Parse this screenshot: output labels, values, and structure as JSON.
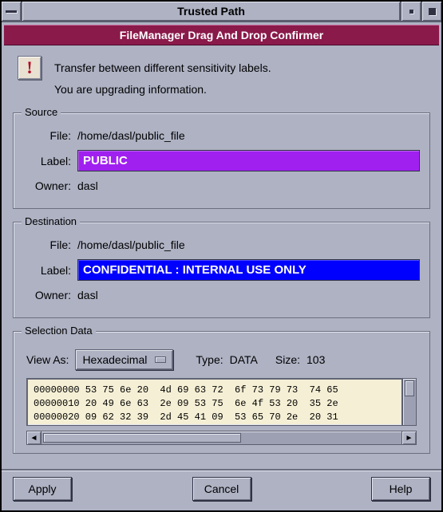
{
  "window": {
    "title": "Trusted Path",
    "subtitle": "FileManager Drag And Drop Confirmer"
  },
  "message": {
    "line1": "Transfer between different sensitivity labels.",
    "line2": "You are upgrading information."
  },
  "source": {
    "legend": "Source",
    "file_label": "File:",
    "file_value": "/home/dasl/public_file",
    "label_label": "Label:",
    "label_value": "PUBLIC",
    "label_color": "#a020f0",
    "owner_label": "Owner:",
    "owner_value": "dasl"
  },
  "destination": {
    "legend": "Destination",
    "file_label": "File:",
    "file_value": "/home/dasl/public_file",
    "label_label": "Label:",
    "label_value": "CONFIDENTIAL : INTERNAL USE ONLY",
    "label_color": "#0000ff",
    "owner_label": "Owner:",
    "owner_value": "dasl"
  },
  "selection": {
    "legend": "Selection Data",
    "view_as_label": "View As:",
    "view_as_value": "Hexadecimal",
    "type_label": "Type:",
    "type_value": "DATA",
    "size_label": "Size:",
    "size_value": "103",
    "hex_lines": "00000000 53 75 6e 20  4d 69 63 72  6f 73 79 73  74 65\n00000010 20 49 6e 63  2e 09 53 75  6e 4f 53 20  35 2e\n00000020 09 62 32 39  2d 45 41 09  53 65 70 2e  20 31"
  },
  "buttons": {
    "apply": "Apply",
    "cancel": "Cancel",
    "help": "Help"
  }
}
